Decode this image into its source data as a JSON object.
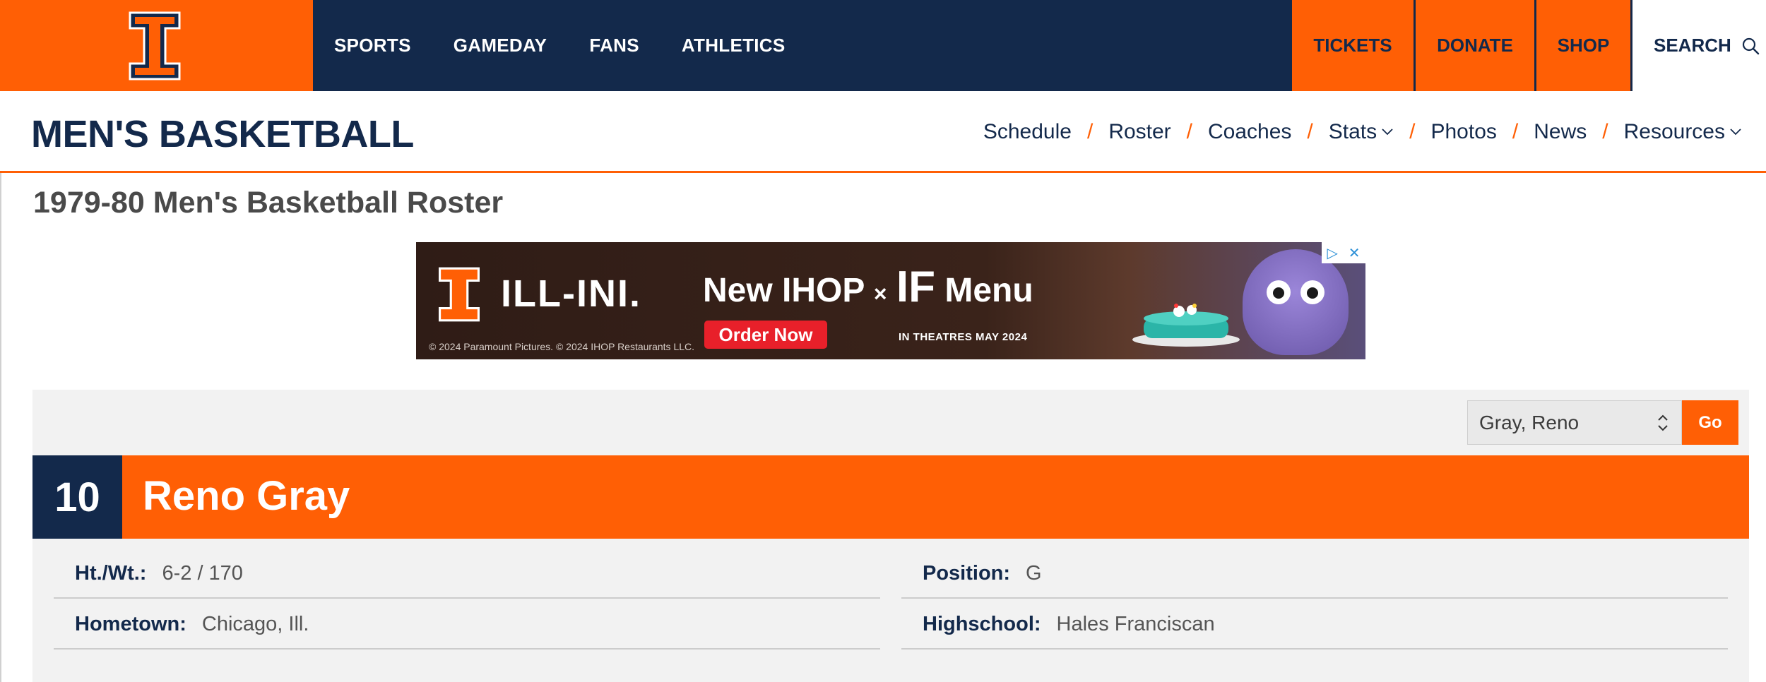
{
  "top_nav": {
    "items": [
      "SPORTS",
      "GAMEDAY",
      "FANS",
      "ATHLETICS"
    ],
    "tickets": "TICKETS",
    "donate": "DONATE",
    "shop": "SHOP",
    "search": "SEARCH"
  },
  "sport_header": {
    "title": "MEN'S BASKETBALL",
    "nav": {
      "schedule": "Schedule",
      "roster": "Roster",
      "coaches": "Coaches",
      "stats": "Stats",
      "photos": "Photos",
      "news": "News",
      "resources": "Resources",
      "separator": "/"
    }
  },
  "page": {
    "title": "1979-80 Men's Basketball Roster"
  },
  "ad": {
    "brand": "ILL-INI.",
    "headline_new": "New",
    "headline_ihop": "IHOP",
    "headline_x": "×",
    "headline_if": "IF",
    "headline_menu": "Menu",
    "cta": "Order Now",
    "copyright": "© 2024 Paramount Pictures. © 2024 IHOP Restaurants LLC.",
    "theatres": "IN THEATRES MAY 2024"
  },
  "player_select": {
    "selected": "Gray, Reno",
    "go_label": "Go"
  },
  "player": {
    "number": "10",
    "name": "Reno Gray",
    "height_weight_label": "Ht./Wt.:",
    "height_weight": "6-2 / 170",
    "position_label": "Position:",
    "position": "G",
    "hometown_label": "Hometown:",
    "hometown": "Chicago, Ill.",
    "highschool_label": "Highschool:",
    "highschool": "Hales Franciscan"
  },
  "colors": {
    "orange": "#ff5f05",
    "navy": "#13294b",
    "panel": "#f2f2f2"
  }
}
